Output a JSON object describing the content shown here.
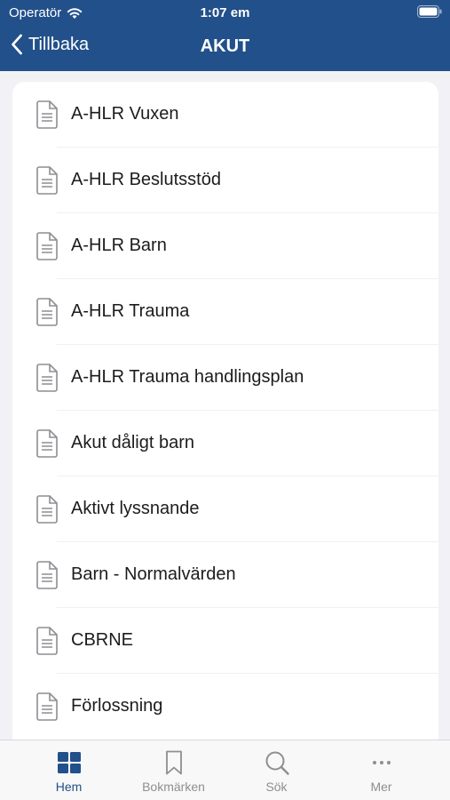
{
  "status_bar": {
    "carrier": "Operatör",
    "time": "1:07 em"
  },
  "navbar": {
    "back_label": "Tillbaka",
    "title": "AKUT"
  },
  "list": {
    "items": [
      {
        "label": "A-HLR Vuxen"
      },
      {
        "label": "A-HLR Beslutsstöd"
      },
      {
        "label": "A-HLR Barn"
      },
      {
        "label": "A-HLR Trauma"
      },
      {
        "label": "A-HLR Trauma handlingsplan"
      },
      {
        "label": "Akut dåligt barn"
      },
      {
        "label": "Aktivt lyssnande"
      },
      {
        "label": "Barn - Normalvärden"
      },
      {
        "label": "CBRNE"
      },
      {
        "label": "Förlossning"
      }
    ]
  },
  "tabbar": {
    "tabs": [
      {
        "label": "Hem",
        "icon": "grid-icon",
        "active": true
      },
      {
        "label": "Bokmärken",
        "icon": "bookmark-icon",
        "active": false
      },
      {
        "label": "Sök",
        "icon": "search-icon",
        "active": false
      },
      {
        "label": "Mer",
        "icon": "more-icon",
        "active": false
      }
    ]
  },
  "colors": {
    "header": "#22508a",
    "active_tab": "#22508a",
    "inactive_tab": "#8e8e93",
    "background": "#f2f2f6"
  }
}
